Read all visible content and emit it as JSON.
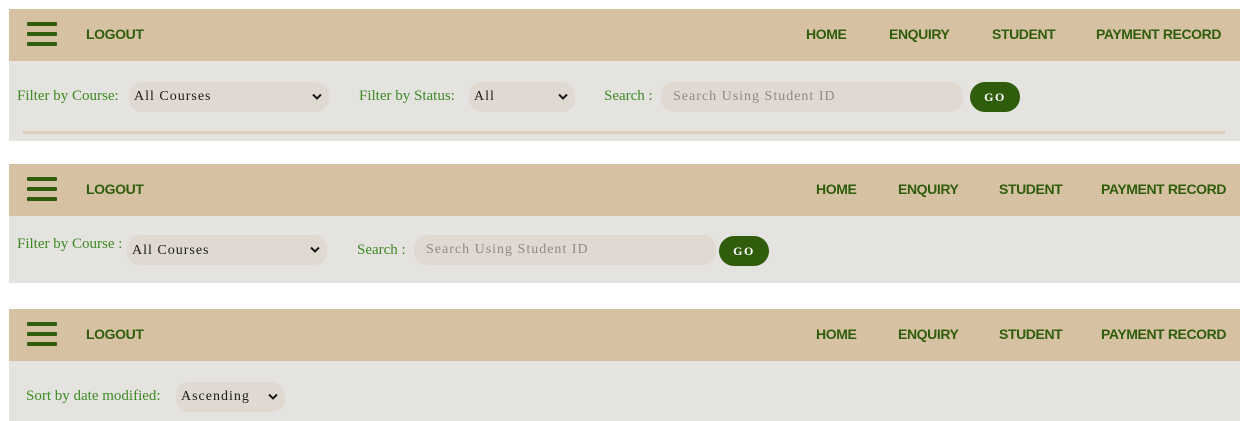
{
  "colors": {
    "navbar_bg": "#d6c2a2",
    "nav_text": "#2f5d0c",
    "panel_bg": "#e5e3e0",
    "label_text": "#3d8a24",
    "control_bg": "#e0d9d2",
    "button_bg": "#2f5d0c"
  },
  "icons": {
    "menu": "hamburger-menu-icon",
    "dropdown": "chevron-down-icon"
  },
  "panel1": {
    "navbar": {
      "logout": "LOGOUT",
      "links": [
        "HOME",
        "ENQUIRY",
        "STUDENT",
        "PAYMENT RECORD"
      ]
    },
    "course_label": "Filter by Course:",
    "course_value": "All Courses",
    "status_label": "Filter by Status:",
    "status_value": "All",
    "search_label": "Search :",
    "search_placeholder": "Search Using Student ID",
    "go_label": "GO"
  },
  "panel2": {
    "navbar": {
      "logout": "LOGOUT",
      "links": [
        "HOME",
        "ENQUIRY",
        "STUDENT",
        "PAYMENT RECORD"
      ]
    },
    "course_label": "Filter by Course :",
    "course_value": "All Courses",
    "search_label": "Search :",
    "search_placeholder": "Search Using Student ID",
    "go_label": "GO"
  },
  "panel3": {
    "navbar": {
      "logout": "LOGOUT",
      "links": [
        "HOME",
        "ENQUIRY",
        "STUDENT",
        "PAYMENT RECORD"
      ]
    },
    "sort_label": "Sort by date modified:",
    "sort_value": "Ascending"
  }
}
